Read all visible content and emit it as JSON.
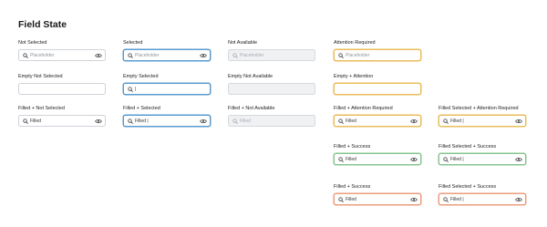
{
  "page": {
    "title": "Field State"
  },
  "states": {
    "not_selected": {
      "label": "Not Selected",
      "text": "Placeholder"
    },
    "selected": {
      "label": "Selected",
      "text": "Placeholder"
    },
    "not_available": {
      "label": "Not Available",
      "text": "Placeholder"
    },
    "attention_required": {
      "label": "Attention Required",
      "text": "Placeholder"
    },
    "empty_not_selected": {
      "label": "Empty Not Selected",
      "text": ""
    },
    "empty_selected": {
      "label": "Empty Selected",
      "text": "|"
    },
    "empty_not_available": {
      "label": "Empty Not Available",
      "text": ""
    },
    "empty_attention": {
      "label": "Empty + Attention",
      "text": ""
    },
    "filled_not_selected": {
      "label": "Filled + Not Selected",
      "text": "Filled"
    },
    "filled_selected": {
      "label": "Filled + Selected",
      "text": "Filled |"
    },
    "filled_not_available": {
      "label": "Filled + Not Available",
      "text": "Filled"
    },
    "filled_attention": {
      "label": "Filled + Attention Required",
      "text": "Filled"
    },
    "filled_sel_attention": {
      "label": "Filled Selected + Attention Required",
      "text": "Filled |"
    },
    "filled_success": {
      "label": "Filled + Success",
      "text": "Filled"
    },
    "filled_sel_success": {
      "label": "Filled Selected + Success",
      "text": "Filled |"
    },
    "filled_success_2": {
      "label": "Filled + Success",
      "text": "Filled"
    },
    "filled_sel_success_2": {
      "label": "Filled Selected + Success",
      "text": "Filled |"
    }
  },
  "colors": {
    "default_border": "#cfd3d8",
    "selected": "#5a9bd0",
    "disabled_bg": "#f0f1f3",
    "attention": "#e9bd5b",
    "success": "#86c58f",
    "error": "#ec9c7e"
  },
  "icons": {
    "leading": "search-icon",
    "trailing": "eye-icon"
  }
}
